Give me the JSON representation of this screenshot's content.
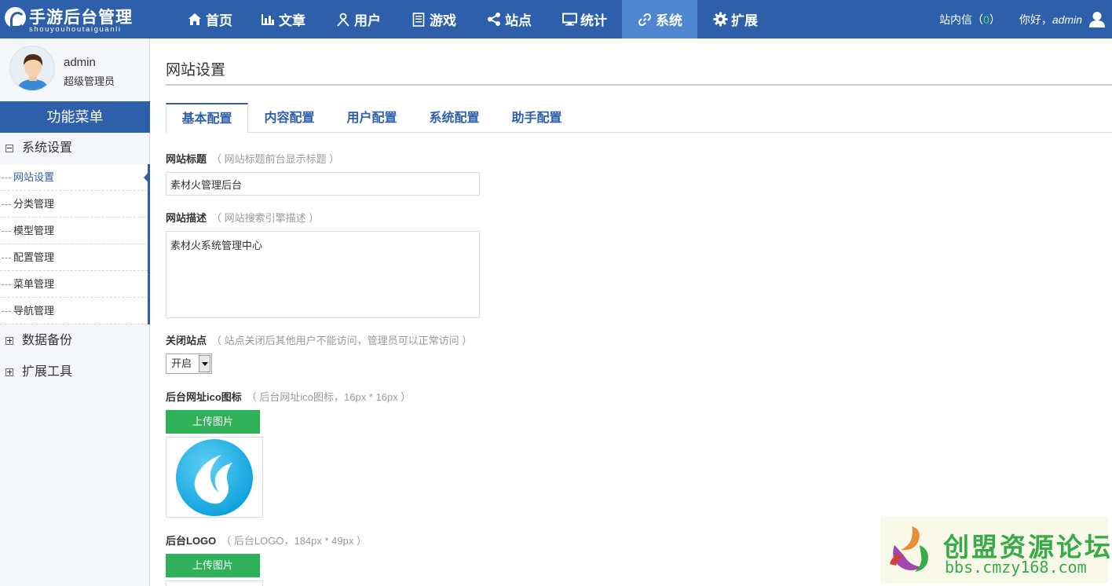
{
  "logo": {
    "title": "手游后台管理",
    "subtitle": "shouyouhoutaiguanli"
  },
  "nav": [
    {
      "label": "首页",
      "icon": "home-icon"
    },
    {
      "label": "文章",
      "icon": "bar-chart-icon"
    },
    {
      "label": "用户",
      "icon": "user-icon"
    },
    {
      "label": "游戏",
      "icon": "document-icon"
    },
    {
      "label": "站点",
      "icon": "share-icon"
    },
    {
      "label": "统计",
      "icon": "monitor-icon"
    },
    {
      "label": "系统",
      "icon": "link-icon",
      "active": true
    },
    {
      "label": "扩展",
      "icon": "gear-icon"
    }
  ],
  "header_right": {
    "messages_label": "站内信（",
    "messages_count": "0",
    "messages_close": "）",
    "greeting": "你好，",
    "username": "admin"
  },
  "profile": {
    "name": "admin",
    "role": "超级管理员"
  },
  "sidebar": {
    "menu_title": "功能菜单",
    "groups": [
      {
        "label": "系统设置",
        "expanded": true
      },
      {
        "label": "数据备份",
        "expanded": false
      },
      {
        "label": "扩展工具",
        "expanded": false
      }
    ],
    "sub_items": [
      "网站设置",
      "分类管理",
      "模型管理",
      "配置管理",
      "菜单管理",
      "导航管理"
    ],
    "active_sub": "网站设置"
  },
  "main": {
    "title": "网站设置",
    "tabs": [
      "基本配置",
      "内容配置",
      "用户配置",
      "系统配置",
      "助手配置"
    ],
    "active_tab": "基本配置",
    "fields": {
      "site_title": {
        "label": "网站标题",
        "hint": "（ 网站标题前台显示标题 ）",
        "value": "素材火管理后台"
      },
      "site_desc": {
        "label": "网站描述",
        "hint": "（ 网站搜索引擎描述 ）",
        "value": "素材火系统管理中心"
      },
      "close_site": {
        "label": "关闭站点",
        "hint": "（ 站点关闭后其他用户不能访问，管理员可以正常访问 ）",
        "value": "开启"
      },
      "favicon": {
        "label": "后台网址ico图标",
        "hint": "（ 后台网址ico图标，16px * 16px ）",
        "button": "上传图片"
      },
      "logo": {
        "label": "后台LOGO",
        "hint": "（ 后台LOGO，184px * 49px ）",
        "button": "上传图片"
      }
    }
  },
  "watermark": {
    "title": "创盟资源论坛",
    "url": "bbs.cmzy168.com"
  },
  "colors": {
    "primary": "#2d5fab",
    "nav_active": "#4f86d1",
    "upload_button": "#2fb15a",
    "link": "#2d5fab"
  }
}
